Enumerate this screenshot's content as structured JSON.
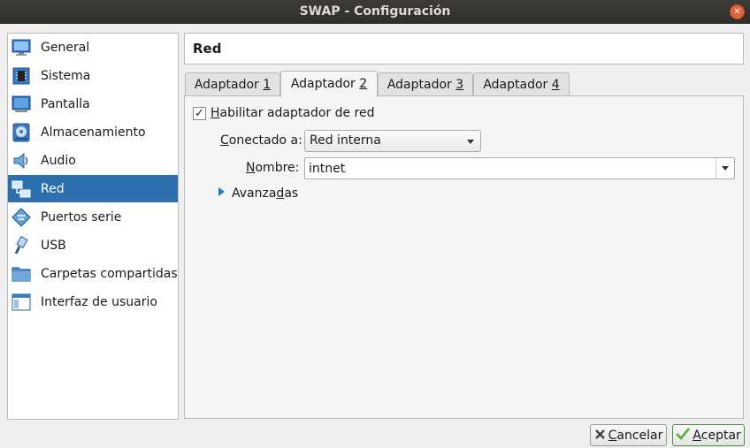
{
  "window": {
    "title": "SWAP - Configuración"
  },
  "sidebar": {
    "items": [
      {
        "label": "General",
        "icon": "monitor-icon"
      },
      {
        "label": "Sistema",
        "icon": "chip-icon"
      },
      {
        "label": "Pantalla",
        "icon": "display-icon"
      },
      {
        "label": "Almacenamiento",
        "icon": "disk-icon"
      },
      {
        "label": "Audio",
        "icon": "speaker-icon"
      },
      {
        "label": "Red",
        "icon": "network-icon",
        "selected": true
      },
      {
        "label": "Puertos serie",
        "icon": "serial-port-icon"
      },
      {
        "label": "USB",
        "icon": "usb-icon"
      },
      {
        "label": "Carpetas compartidas",
        "icon": "folder-icon"
      },
      {
        "label": "Interfaz de usuario",
        "icon": "ui-window-icon"
      }
    ]
  },
  "header": {
    "title": "Red"
  },
  "tabs": [
    {
      "prefix": "Adaptador ",
      "mnemonic": "1"
    },
    {
      "prefix": "Adaptador ",
      "mnemonic": "2",
      "active": true
    },
    {
      "prefix": "Adaptador ",
      "mnemonic": "3"
    },
    {
      "prefix": "Adaptador ",
      "mnemonic": "4"
    }
  ],
  "adapter": {
    "enable_mnemonic": "H",
    "enable_rest": "abilitar adaptador de red",
    "enable_checked": true,
    "attached_mnemonic": "C",
    "attached_rest": "onectado a:",
    "attached_value": "Red interna",
    "name_mnemonic": "N",
    "name_rest": "ombre:",
    "name_value": "intnet",
    "advanced_pre": "Avanza",
    "advanced_mnemonic": "d",
    "advanced_post": "as"
  },
  "buttons": {
    "cancel_mnemonic": "C",
    "cancel_rest": "ancelar",
    "ok_mnemonic": "A",
    "ok_rest": "ceptar"
  },
  "colors": {
    "selection": "#2b6fad",
    "titlebar": "#3c3b37",
    "close": "#e3643b",
    "accent_blue": "#2b78c4",
    "ok_check": "#4caf2e"
  }
}
